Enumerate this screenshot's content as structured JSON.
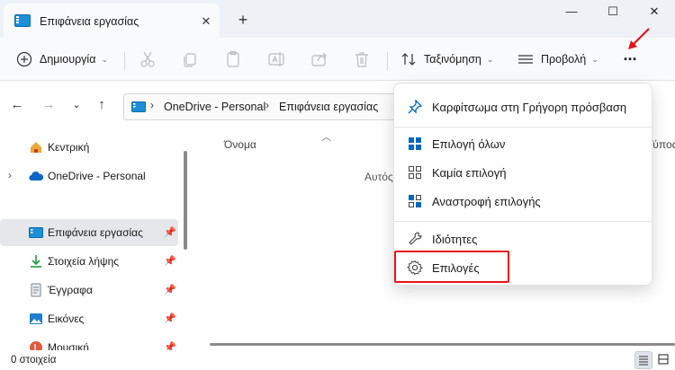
{
  "tab": {
    "title": "Επιφάνεια εργασίας",
    "close": "✕",
    "new_tab": "+"
  },
  "window_controls": {
    "minimize": "—",
    "maximize": "☐",
    "close": "✕"
  },
  "toolbar": {
    "new_label": "Δημιουργία",
    "sort_label": "Ταξινόμηση",
    "view_label": "Προβολή",
    "more_label": "···"
  },
  "address": {
    "segments": [
      "OneDrive - Personal",
      "Επιφάνεια εργασίας"
    ]
  },
  "sidebar": {
    "items": [
      {
        "label": "Κεντρική"
      },
      {
        "label": "OneDrive - Personal"
      },
      {
        "label": "Επιφάνεια εργασίας"
      },
      {
        "label": "Στοιχεία λήψης"
      },
      {
        "label": "Έγγραφα"
      },
      {
        "label": "Εικόνες"
      },
      {
        "label": "Μουσική"
      }
    ]
  },
  "content": {
    "col_name": "Όνομα",
    "col_type": "Τύπος",
    "empty_text": "Αυτός"
  },
  "status": {
    "items_count": "0 στοιχεία"
  },
  "menu": {
    "items": [
      {
        "label": "Καρφίτσωμα στη Γρήγορη πρόσβαση",
        "icon": "pin-icon"
      },
      {
        "label": "Επιλογή όλων",
        "icon": "select-all-icon"
      },
      {
        "label": "Καμία επιλογή",
        "icon": "select-none-icon"
      },
      {
        "label": "Αναστροφή επιλογής",
        "icon": "invert-selection-icon"
      },
      {
        "label": "Ιδιότητες",
        "icon": "properties-icon"
      },
      {
        "label": "Επιλογές",
        "icon": "gear-icon"
      }
    ]
  },
  "colors": {
    "accent": "#0067c0",
    "highlight": "#e8131b",
    "selected_bg": "#e5e7eb"
  }
}
